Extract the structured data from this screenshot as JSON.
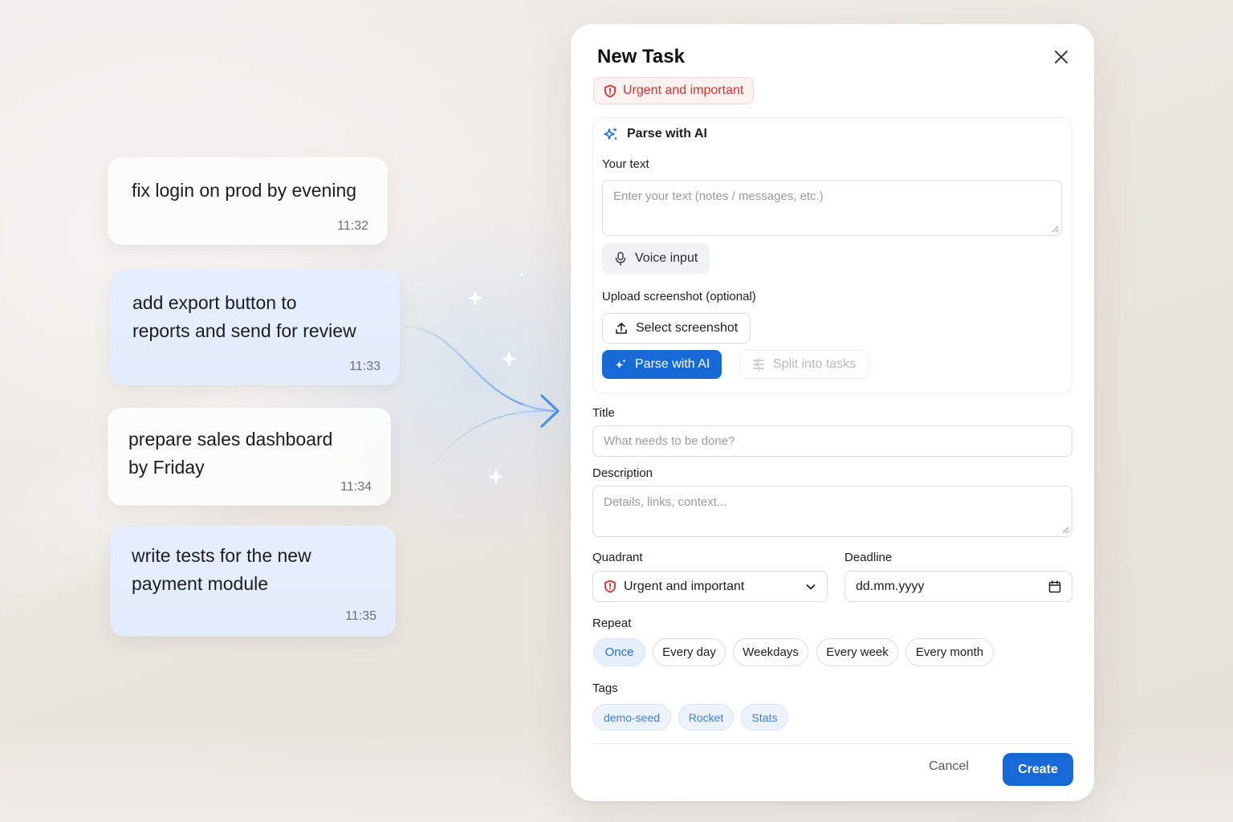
{
  "messages": [
    {
      "text": "fix login on prod by evening",
      "time": "11:32"
    },
    {
      "text": "add export button to\nreports and send for review",
      "time": "11:33"
    },
    {
      "text": "prepare sales dashboard\nby Friday",
      "time": "11:34"
    },
    {
      "text": "write tests for the new\npayment module",
      "time": "11:35"
    }
  ],
  "dialog": {
    "title": "New Task",
    "priority_chip": "Urgent and important",
    "ai": {
      "header": "Parse with AI",
      "text_label": "Your text",
      "text_placeholder": "Enter your text (notes / messages, etc.)",
      "voice_button": "Voice input",
      "upload_label": "Upload screenshot (optional)",
      "select_button": "Select screenshot",
      "parse_button": "Parse with AI",
      "split_button": "Split into tasks"
    },
    "title_label": "Title",
    "title_placeholder": "What needs to be done?",
    "description_label": "Description",
    "description_placeholder": "Details, links, context...",
    "quadrant_label": "Quadrant",
    "quadrant_value": "Urgent and important",
    "deadline_label": "Deadline",
    "deadline_placeholder": "dd.mm.yyyy",
    "repeat_label": "Repeat",
    "repeat_options": [
      "Once",
      "Every day",
      "Weekdays",
      "Every week",
      "Every month"
    ],
    "repeat_selected": "Once",
    "tags_label": "Tags",
    "tags": [
      "demo-seed",
      "Rocket",
      "Stats"
    ],
    "cancel": "Cancel",
    "create": "Create"
  },
  "colors": {
    "accent": "#1769d8",
    "urgent": "#d93025",
    "tag": "#3a7fd8",
    "sparkle": "#1769d8"
  },
  "icons": [
    "shield-icon",
    "sparkle-icon",
    "microphone-icon",
    "upload-icon",
    "split-icon",
    "chevron-down-icon",
    "calendar-icon",
    "close-icon",
    "arrow-icon"
  ]
}
